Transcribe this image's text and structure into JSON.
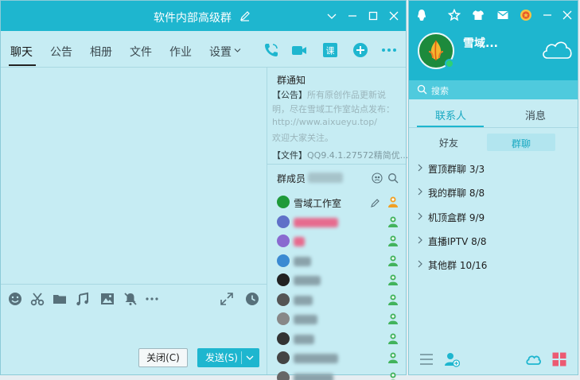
{
  "chat": {
    "title": "软件内部高级群",
    "tabs": [
      "聊天",
      "公告",
      "相册",
      "文件",
      "作业",
      "设置"
    ],
    "tab_icons": [
      "phone-icon",
      "video-icon",
      "class-icon",
      "add-icon",
      "more-icon"
    ],
    "tool_icons": [
      "emoji-icon",
      "scissors-icon",
      "folder-icon",
      "music-icon",
      "image-icon",
      "mute-icon",
      "more-dots-icon",
      "expand-icon",
      "history-icon"
    ],
    "close_label": "关闭(C)",
    "send_label": "发送(S)",
    "notice": {
      "title": "群通知",
      "lines": [
        {
          "key": "【公告】",
          "text": "所有原创作品更新说"
        },
        {
          "key": "",
          "text": "明，尽在雪域工作室站点发布："
        },
        {
          "key": "",
          "text": "http://www.aixueyu.top/"
        },
        {
          "key": "",
          "text": "欢迎大家关注。"
        }
      ],
      "file_key": "【文件】",
      "file_text": "QQ9.4.1.27572精简优..."
    },
    "members_title": "群成员",
    "members": [
      {
        "name": "雪域工作室",
        "avatar": "#1f9a3a",
        "blurred": false,
        "blur_width": 0,
        "blur_color": ""
      },
      {
        "name": "",
        "avatar": "#6070c8",
        "blurred": true,
        "blur_width": 56,
        "blur_color": "#e76b8e"
      },
      {
        "name": "",
        "avatar": "#8a6ad0",
        "blurred": true,
        "blur_width": 14,
        "blur_color": "#e76b8e"
      },
      {
        "name": "",
        "avatar": "#3b8ad2",
        "blurred": true,
        "blur_width": 22,
        "blur_color": "#8aa2aa"
      },
      {
        "name": "",
        "avatar": "#222222",
        "blurred": true,
        "blur_width": 34,
        "blur_color": "#8aa2aa"
      },
      {
        "name": "",
        "avatar": "#555555",
        "blurred": true,
        "blur_width": 24,
        "blur_color": "#8aa2aa"
      },
      {
        "name": "",
        "avatar": "#888888",
        "blurred": true,
        "blur_width": 30,
        "blur_color": "#8aa2aa"
      },
      {
        "name": "",
        "avatar": "#333333",
        "blurred": true,
        "blur_width": 26,
        "blur_color": "#8aa2aa"
      },
      {
        "name": "",
        "avatar": "#444444",
        "blurred": true,
        "blur_width": 56,
        "blur_color": "#8aa2aa"
      },
      {
        "name": "",
        "avatar": "#666666",
        "blurred": true,
        "blur_width": 50,
        "blur_color": "#8aa2aa"
      }
    ]
  },
  "main": {
    "profile_name": "雪域...",
    "search_placeholder": "搜索",
    "tab_contacts": "联系人",
    "tab_messages": "消息",
    "subtab_friends": "好友",
    "subtab_groups": "群聊",
    "groups": [
      {
        "name": "置顶群聊",
        "count": "3/3"
      },
      {
        "name": "我的群聊",
        "count": "8/8"
      },
      {
        "name": "机顶盒群",
        "count": "9/9"
      },
      {
        "name": "直播IPTV",
        "count": "8/8"
      },
      {
        "name": "其他群",
        "count": "10/16"
      }
    ],
    "top_icons": [
      "qq-icon",
      "star-icon",
      "shirt-icon",
      "mail-icon",
      "coin-icon"
    ],
    "footer_icons": [
      "menu-icon",
      "add-contact-icon",
      "cloud-icon",
      "apps-icon"
    ]
  },
  "colors": {
    "accent": "#1eb6cf",
    "panel_bg": "#c6ecf3",
    "link": "#17a8c1"
  }
}
